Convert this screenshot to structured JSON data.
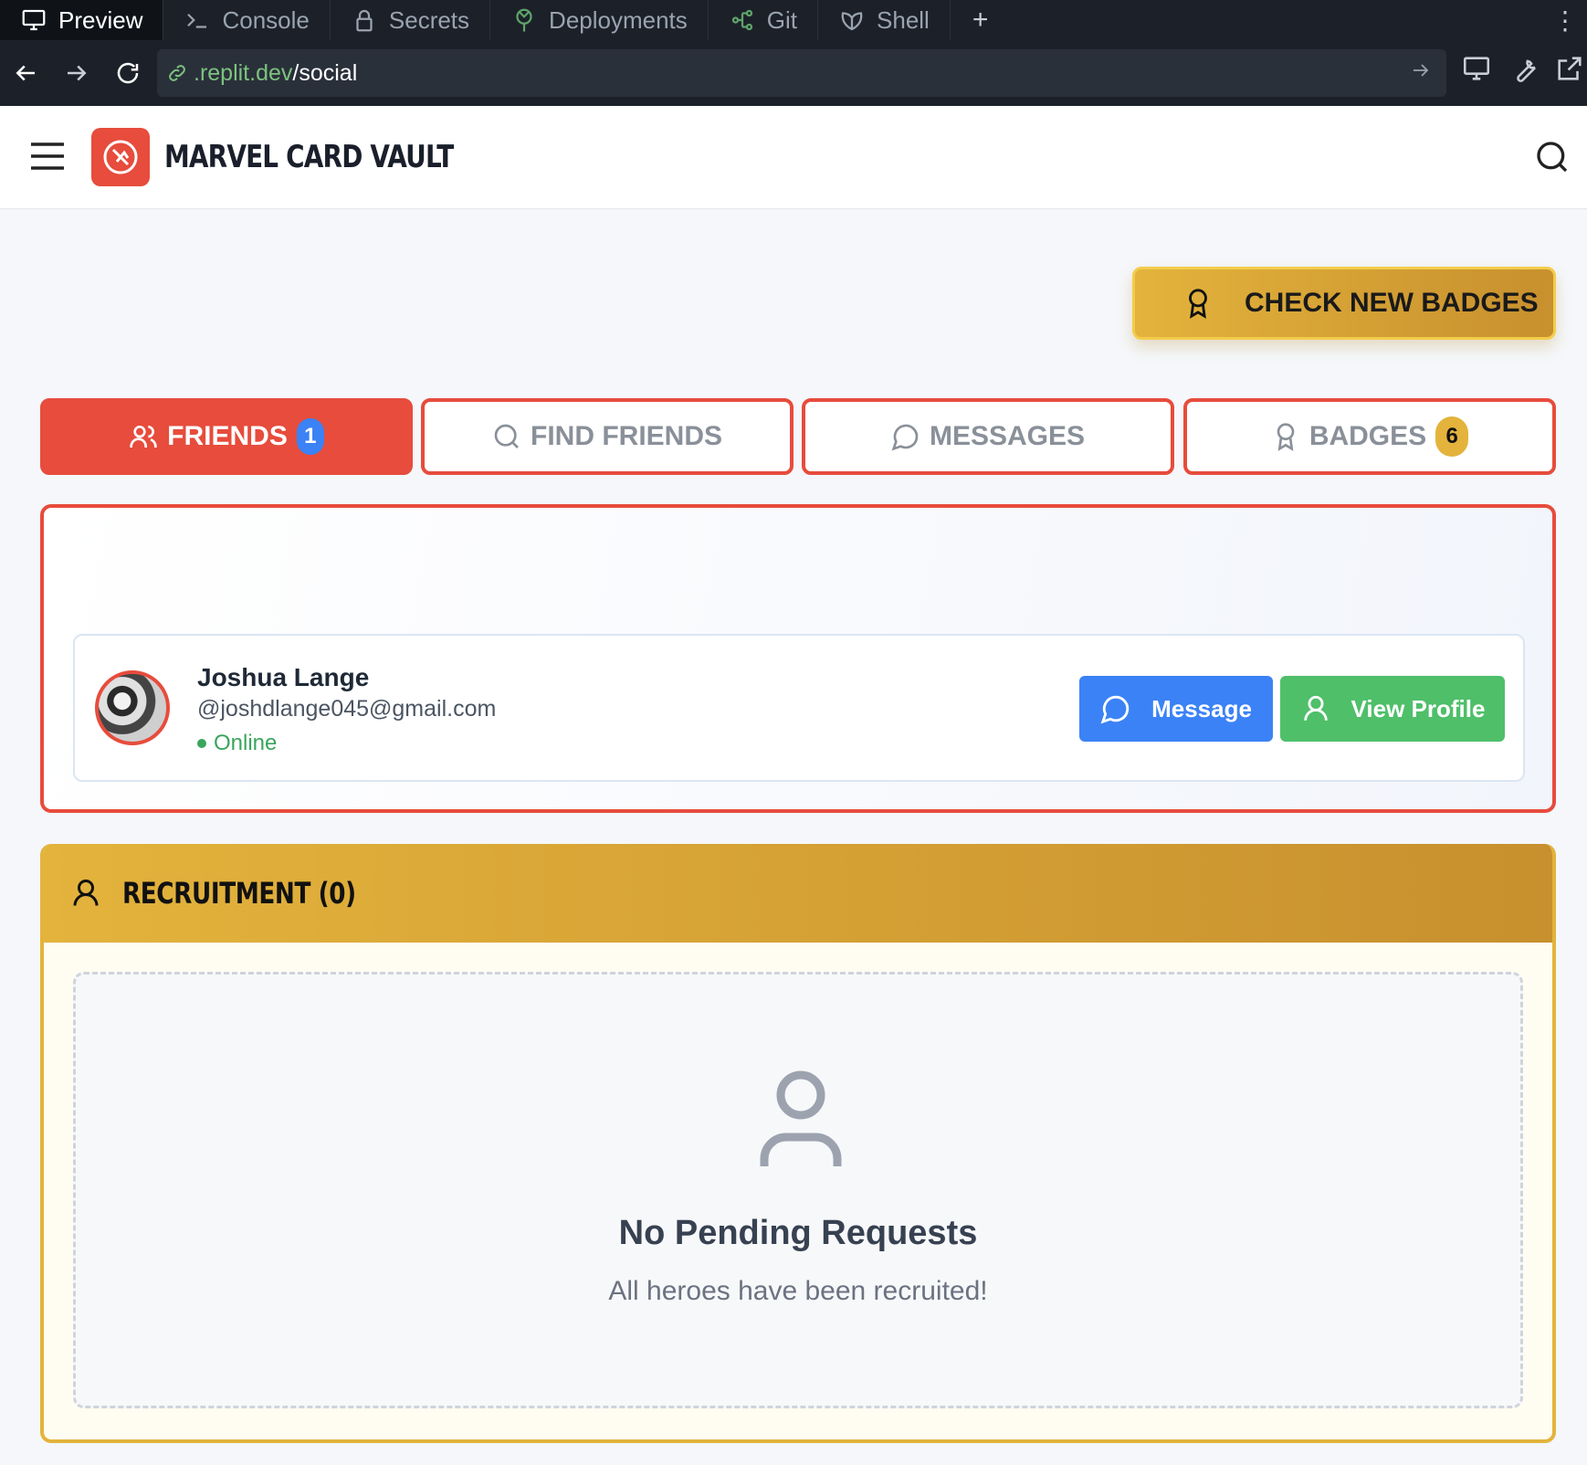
{
  "browser": {
    "tabs": [
      {
        "label": "Preview",
        "icon": "monitor-icon",
        "active": true
      },
      {
        "label": "Console",
        "icon": "terminal-icon",
        "active": false
      },
      {
        "label": "Secrets",
        "icon": "lock-icon",
        "active": false
      },
      {
        "label": "Deployments",
        "icon": "deploy-icon",
        "active": false
      },
      {
        "label": "Git",
        "icon": "git-icon",
        "active": false
      },
      {
        "label": "Shell",
        "icon": "shell-icon",
        "active": false
      }
    ],
    "add_tab": "+",
    "more": "⋮",
    "url_host": ".replit.dev",
    "url_path": "/social"
  },
  "app": {
    "title": "MARVEL CARD VAULT",
    "brand_color": "#e74c3c",
    "gold_color": "#e3b33c"
  },
  "actions": {
    "check_badges": "CHECK NEW BADGES"
  },
  "tabs": {
    "friends": {
      "label": "FRIENDS",
      "count": "1"
    },
    "find": {
      "label": "FIND FRIENDS"
    },
    "messages": {
      "label": "MESSAGES"
    },
    "badges": {
      "label": "BADGES",
      "count": "6"
    }
  },
  "friend": {
    "name": "Joshua Lange",
    "handle": "@joshdlange045@gmail.com",
    "status": "Online",
    "message_label": "Message",
    "profile_label": "View Profile"
  },
  "recruitment": {
    "title": "RECRUITMENT (0)",
    "empty_title": "No Pending Requests",
    "empty_subtitle": "All heroes have been recruited!"
  }
}
